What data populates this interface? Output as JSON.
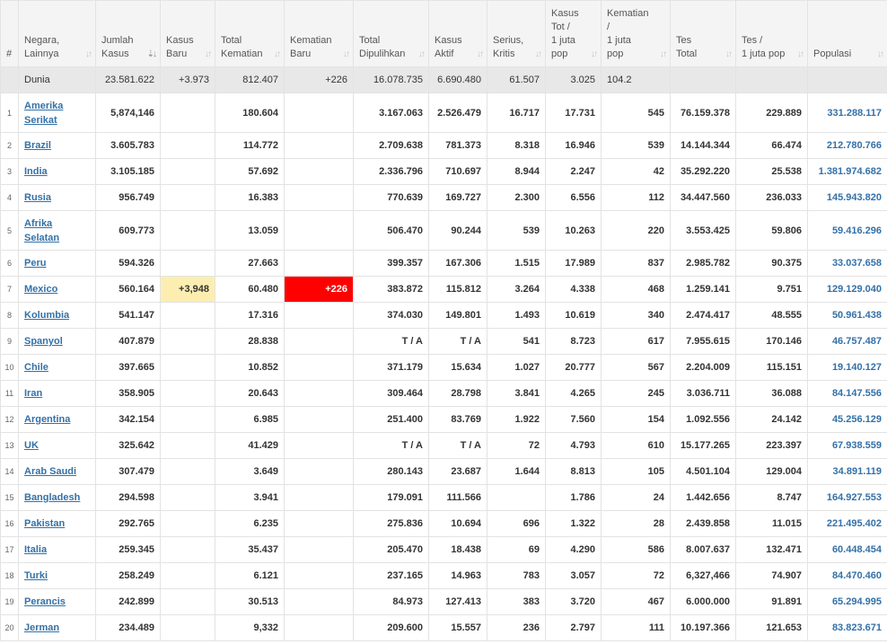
{
  "headers": [
    {
      "lines": [
        "#"
      ],
      "sortable": false
    },
    {
      "lines": [
        "Negara,",
        "Lainnya"
      ],
      "sortable": true
    },
    {
      "lines": [
        "Jumlah",
        "Kasus"
      ],
      "sortable": true,
      "active": true
    },
    {
      "lines": [
        "Kasus",
        "Baru"
      ],
      "sortable": true
    },
    {
      "lines": [
        "Total",
        "Kematian"
      ],
      "sortable": true
    },
    {
      "lines": [
        "Kematian",
        "Baru"
      ],
      "sortable": true
    },
    {
      "lines": [
        "Total",
        "Dipulihkan"
      ],
      "sortable": true
    },
    {
      "lines": [
        "Kasus",
        "Aktif"
      ],
      "sortable": true
    },
    {
      "lines": [
        "Serius,",
        "Kritis"
      ],
      "sortable": true
    },
    {
      "lines": [
        "Kasus",
        "Tot /",
        "1 juta",
        "pop"
      ],
      "sortable": true
    },
    {
      "lines": [
        "Kematian",
        "/",
        "1 juta",
        "pop"
      ],
      "sortable": true
    },
    {
      "lines": [
        "Tes",
        "Total"
      ],
      "sortable": true
    },
    {
      "lines": [
        "Tes /",
        "1 juta pop"
      ],
      "sortable": true
    },
    {
      "lines": [
        "Populasi"
      ],
      "sortable": true
    }
  ],
  "world": {
    "name": "Dunia",
    "cases": "23.581.622",
    "new_cases": "+3.973",
    "deaths": "812.407",
    "new_deaths": "+226",
    "recovered": "16.078.735",
    "active": "6.690.480",
    "critical": "61.507",
    "cases_per_m": "3.025",
    "deaths_per_m": "104.2",
    "tests": "",
    "tests_per_m": "",
    "population": ""
  },
  "rows": [
    {
      "idx": "1",
      "name": "Amerika Serikat",
      "cases": "5,874,146",
      "new_cases": "",
      "deaths": "180.604",
      "new_deaths": "",
      "recovered": "3.167.063",
      "active": "2.526.479",
      "critical": "16.717",
      "cases_per_m": "17.731",
      "deaths_per_m": "545",
      "tests": "76.159.378",
      "tests_per_m": "229.889",
      "population": "331.288.117"
    },
    {
      "idx": "2",
      "name": "Brazil",
      "cases": "3.605.783",
      "new_cases": "",
      "deaths": "114.772",
      "new_deaths": "",
      "recovered": "2.709.638",
      "active": "781.373",
      "critical": "8.318",
      "cases_per_m": "16.946",
      "deaths_per_m": "539",
      "tests": "14.144.344",
      "tests_per_m": "66.474",
      "population": "212.780.766"
    },
    {
      "idx": "3",
      "name": "India",
      "cases": "3.105.185",
      "new_cases": "",
      "deaths": "57.692",
      "new_deaths": "",
      "recovered": "2.336.796",
      "active": "710.697",
      "critical": "8.944",
      "cases_per_m": "2.247",
      "deaths_per_m": "42",
      "tests": "35.292.220",
      "tests_per_m": "25.538",
      "population": "1.381.974.682"
    },
    {
      "idx": "4",
      "name": "Rusia",
      "cases": "956.749",
      "new_cases": "",
      "deaths": "16.383",
      "new_deaths": "",
      "recovered": "770.639",
      "active": "169.727",
      "critical": "2.300",
      "cases_per_m": "6.556",
      "deaths_per_m": "112",
      "tests": "34.447.560",
      "tests_per_m": "236.033",
      "population": "145.943.820"
    },
    {
      "idx": "5",
      "name": "Afrika Selatan",
      "cases": "609.773",
      "new_cases": "",
      "deaths": "13.059",
      "new_deaths": "",
      "recovered": "506.470",
      "active": "90.244",
      "critical": "539",
      "cases_per_m": "10.263",
      "deaths_per_m": "220",
      "tests": "3.553.425",
      "tests_per_m": "59.806",
      "population": "59.416.296"
    },
    {
      "idx": "6",
      "name": "Peru",
      "cases": "594.326",
      "new_cases": "",
      "deaths": "27.663",
      "new_deaths": "",
      "recovered": "399.357",
      "active": "167.306",
      "critical": "1.515",
      "cases_per_m": "17.989",
      "deaths_per_m": "837",
      "tests": "2.985.782",
      "tests_per_m": "90.375",
      "population": "33.037.658"
    },
    {
      "idx": "7",
      "name": "Mexico",
      "cases": "560.164",
      "new_cases": "+3,948",
      "deaths": "60.480",
      "new_deaths": "+226",
      "recovered": "383.872",
      "active": "115.812",
      "critical": "3.264",
      "cases_per_m": "4.338",
      "deaths_per_m": "468",
      "tests": "1.259.141",
      "tests_per_m": "9.751",
      "population": "129.129.040"
    },
    {
      "idx": "8",
      "name": "Kolumbia",
      "cases": "541.147",
      "new_cases": "",
      "deaths": "17.316",
      "new_deaths": "",
      "recovered": "374.030",
      "active": "149.801",
      "critical": "1.493",
      "cases_per_m": "10.619",
      "deaths_per_m": "340",
      "tests": "2.474.417",
      "tests_per_m": "48.555",
      "population": "50.961.438"
    },
    {
      "idx": "9",
      "name": "Spanyol",
      "cases": "407.879",
      "new_cases": "",
      "deaths": "28.838",
      "new_deaths": "",
      "recovered": "T / A",
      "active": "T / A",
      "critical": "541",
      "cases_per_m": "8.723",
      "deaths_per_m": "617",
      "tests": "7.955.615",
      "tests_per_m": "170.146",
      "population": "46.757.487"
    },
    {
      "idx": "10",
      "name": "Chile",
      "cases": "397.665",
      "new_cases": "",
      "deaths": "10.852",
      "new_deaths": "",
      "recovered": "371.179",
      "active": "15.634",
      "critical": "1.027",
      "cases_per_m": "20.777",
      "deaths_per_m": "567",
      "tests": "2.204.009",
      "tests_per_m": "115.151",
      "population": "19.140.127"
    },
    {
      "idx": "11",
      "name": "Iran",
      "cases": "358.905",
      "new_cases": "",
      "deaths": "20.643",
      "new_deaths": "",
      "recovered": "309.464",
      "active": "28.798",
      "critical": "3.841",
      "cases_per_m": "4.265",
      "deaths_per_m": "245",
      "tests": "3.036.711",
      "tests_per_m": "36.088",
      "population": "84.147.556"
    },
    {
      "idx": "12",
      "name": "Argentina",
      "cases": "342.154",
      "new_cases": "",
      "deaths": "6.985",
      "new_deaths": "",
      "recovered": "251.400",
      "active": "83.769",
      "critical": "1.922",
      "cases_per_m": "7.560",
      "deaths_per_m": "154",
      "tests": "1.092.556",
      "tests_per_m": "24.142",
      "population": "45.256.129"
    },
    {
      "idx": "13",
      "name": "UK",
      "cases": "325.642",
      "new_cases": "",
      "deaths": "41.429",
      "new_deaths": "",
      "recovered": "T / A",
      "active": "T / A",
      "critical": "72",
      "cases_per_m": "4.793",
      "deaths_per_m": "610",
      "tests": "15.177.265",
      "tests_per_m": "223.397",
      "population": "67.938.559"
    },
    {
      "idx": "14",
      "name": "Arab Saudi",
      "cases": "307.479",
      "new_cases": "",
      "deaths": "3.649",
      "new_deaths": "",
      "recovered": "280.143",
      "active": "23.687",
      "critical": "1.644",
      "cases_per_m": "8.813",
      "deaths_per_m": "105",
      "tests": "4.501.104",
      "tests_per_m": "129.004",
      "population": "34.891.119"
    },
    {
      "idx": "15",
      "name": "Bangladesh",
      "cases": "294.598",
      "new_cases": "",
      "deaths": "3.941",
      "new_deaths": "",
      "recovered": "179.091",
      "active": "111.566",
      "critical": "",
      "cases_per_m": "1.786",
      "deaths_per_m": "24",
      "tests": "1.442.656",
      "tests_per_m": "8.747",
      "population": "164.927.553"
    },
    {
      "idx": "16",
      "name": "Pakistan",
      "cases": "292.765",
      "new_cases": "",
      "deaths": "6.235",
      "new_deaths": "",
      "recovered": "275.836",
      "active": "10.694",
      "critical": "696",
      "cases_per_m": "1.322",
      "deaths_per_m": "28",
      "tests": "2.439.858",
      "tests_per_m": "11.015",
      "population": "221.495.402"
    },
    {
      "idx": "17",
      "name": "Italia",
      "cases": "259.345",
      "new_cases": "",
      "deaths": "35.437",
      "new_deaths": "",
      "recovered": "205.470",
      "active": "18.438",
      "critical": "69",
      "cases_per_m": "4.290",
      "deaths_per_m": "586",
      "tests": "8.007.637",
      "tests_per_m": "132.471",
      "population": "60.448.454"
    },
    {
      "idx": "18",
      "name": "Turki",
      "cases": "258.249",
      "new_cases": "",
      "deaths": "6.121",
      "new_deaths": "",
      "recovered": "237.165",
      "active": "14.963",
      "critical": "783",
      "cases_per_m": "3.057",
      "deaths_per_m": "72",
      "tests": "6,327,466",
      "tests_per_m": "74.907",
      "population": "84.470.460"
    },
    {
      "idx": "19",
      "name": "Perancis",
      "cases": "242.899",
      "new_cases": "",
      "deaths": "30.513",
      "new_deaths": "",
      "recovered": "84.973",
      "active": "127.413",
      "critical": "383",
      "cases_per_m": "3.720",
      "deaths_per_m": "467",
      "tests": "6.000.000",
      "tests_per_m": "91.891",
      "population": "65.294.995"
    },
    {
      "idx": "20",
      "name": "Jerman",
      "cases": "234.489",
      "new_cases": "",
      "deaths": "9,332",
      "new_deaths": "",
      "recovered": "209.600",
      "active": "15.557",
      "critical": "236",
      "cases_per_m": "2.797",
      "deaths_per_m": "111",
      "tests": "10.197.366",
      "tests_per_m": "121.653",
      "population": "83.823.671"
    }
  ]
}
